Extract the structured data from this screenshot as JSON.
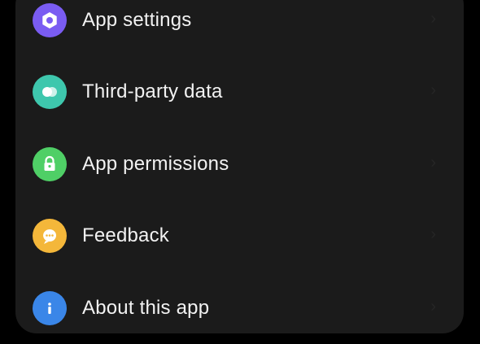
{
  "menu": {
    "items": [
      {
        "label": "App settings",
        "icon": "settings-icon",
        "color": "#7a5cf2"
      },
      {
        "label": "Third-party data",
        "icon": "third-party-data-icon",
        "color": "#3ec7ad"
      },
      {
        "label": "App permissions",
        "icon": "lock-icon",
        "color": "#4fcf66"
      },
      {
        "label": "Feedback",
        "icon": "feedback-icon",
        "color": "#f4b73a"
      },
      {
        "label": "About this app",
        "icon": "info-icon",
        "color": "#3a86e8"
      }
    ]
  }
}
